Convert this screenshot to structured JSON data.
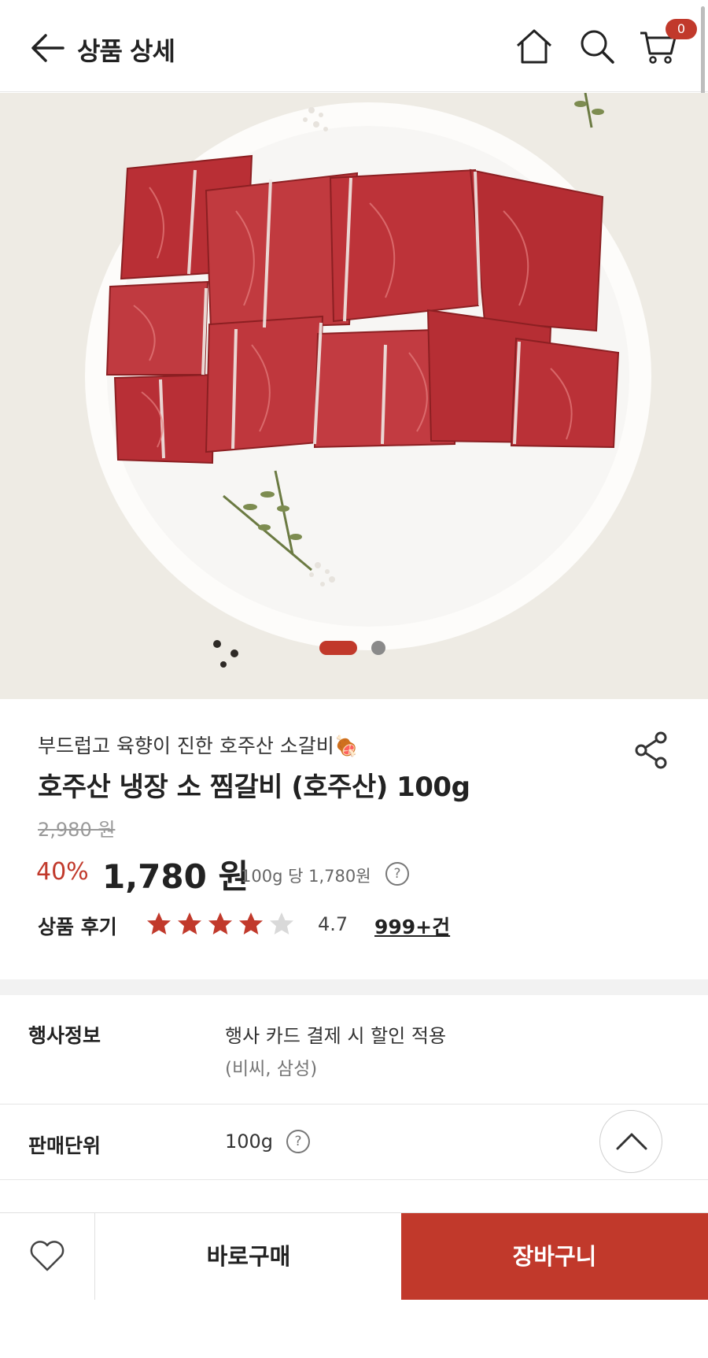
{
  "header": {
    "title": "상품 상세",
    "cart_count": "0"
  },
  "gallery": {
    "slide_count": 2,
    "active_slide": 1
  },
  "product": {
    "subtitle": "부드럽고 육향이 진한 호주산 소갈비🍖",
    "name": "호주산 냉장 소 찜갈비 (호주산) 100g",
    "original_price": "2,980 원",
    "discount": "40%",
    "price": "1,780 원",
    "unit_price": "100g 당 1,780원",
    "review_label": "상품 후기",
    "rating": "4.7",
    "review_count": "999+건"
  },
  "info": {
    "promo_label": "행사정보",
    "promo_value": "행사 카드 결제 시 할인 적용",
    "promo_sub": "(비씨, 삼성)",
    "unit_label": "판매단위",
    "unit_value": "100g"
  },
  "bottom": {
    "buy_now": "바로구매",
    "add_to_cart": "장바구니"
  },
  "colors": {
    "accent": "#c1392b"
  },
  "icons": [
    "back-arrow-icon",
    "home-icon",
    "search-icon",
    "cart-icon",
    "share-icon",
    "help-circle-icon",
    "star-icon",
    "chevron-up-icon",
    "heart-icon"
  ]
}
